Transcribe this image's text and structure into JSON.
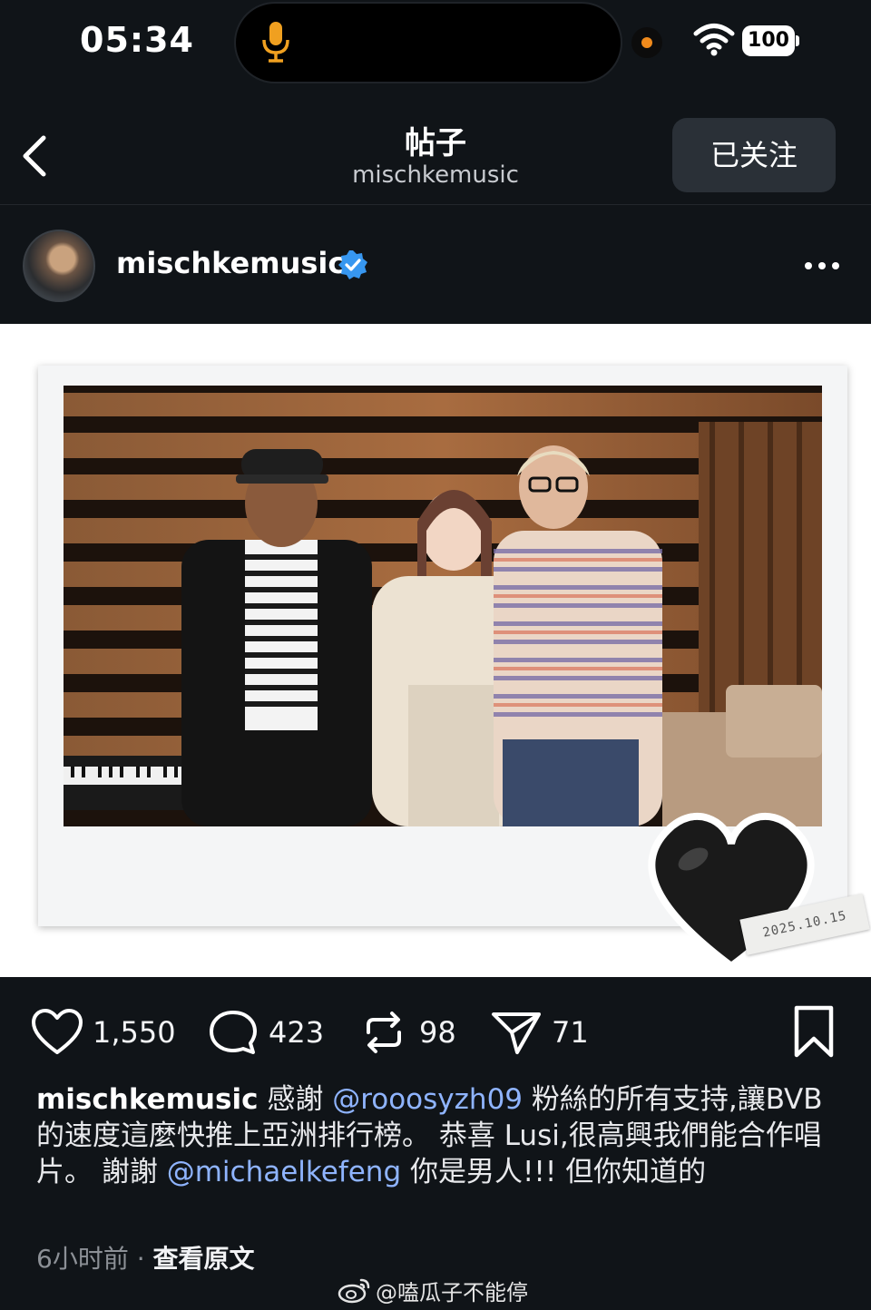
{
  "status_bar": {
    "time": "05:34",
    "battery": "100",
    "icons": [
      "microphone-icon",
      "wifi-icon",
      "battery-icon"
    ]
  },
  "nav": {
    "title": "帖子",
    "subtitle": "mischkemusic",
    "follow_label": "已关注",
    "back_icon": "chevron-left-icon"
  },
  "author": {
    "username": "mischkemusic",
    "verified": true,
    "more_icon": "more-horizontal-icon"
  },
  "photo": {
    "date_stamp": "2025.10.15",
    "sticker": "black-heart"
  },
  "actions": {
    "likes": "1,550",
    "comments": "423",
    "reposts": "98",
    "shares": "71"
  },
  "caption": {
    "username": "mischkemusic",
    "text_1": " 感謝 ",
    "mention_1": "@rooosyzh09",
    "text_2": " 粉絲的所有支持,讓BVB 的速度這麼快推上亞洲排行榜。 恭喜 Lusi,很高興我們能合作唱片。 謝謝 ",
    "mention_2": "@michaelkefeng",
    "text_3": " 你是男人!!! 但你知道的"
  },
  "meta": {
    "time_ago": "6小时前",
    "separator": " · ",
    "view_original": "查看原文"
  },
  "watermark": {
    "text": "@嗑瓜子不能停"
  },
  "colors": {
    "background": "#101418",
    "mention": "#8fb4ff",
    "verified": "#3797f0",
    "follow_button": "#2a3037",
    "status_dot": "#f08a1c"
  }
}
